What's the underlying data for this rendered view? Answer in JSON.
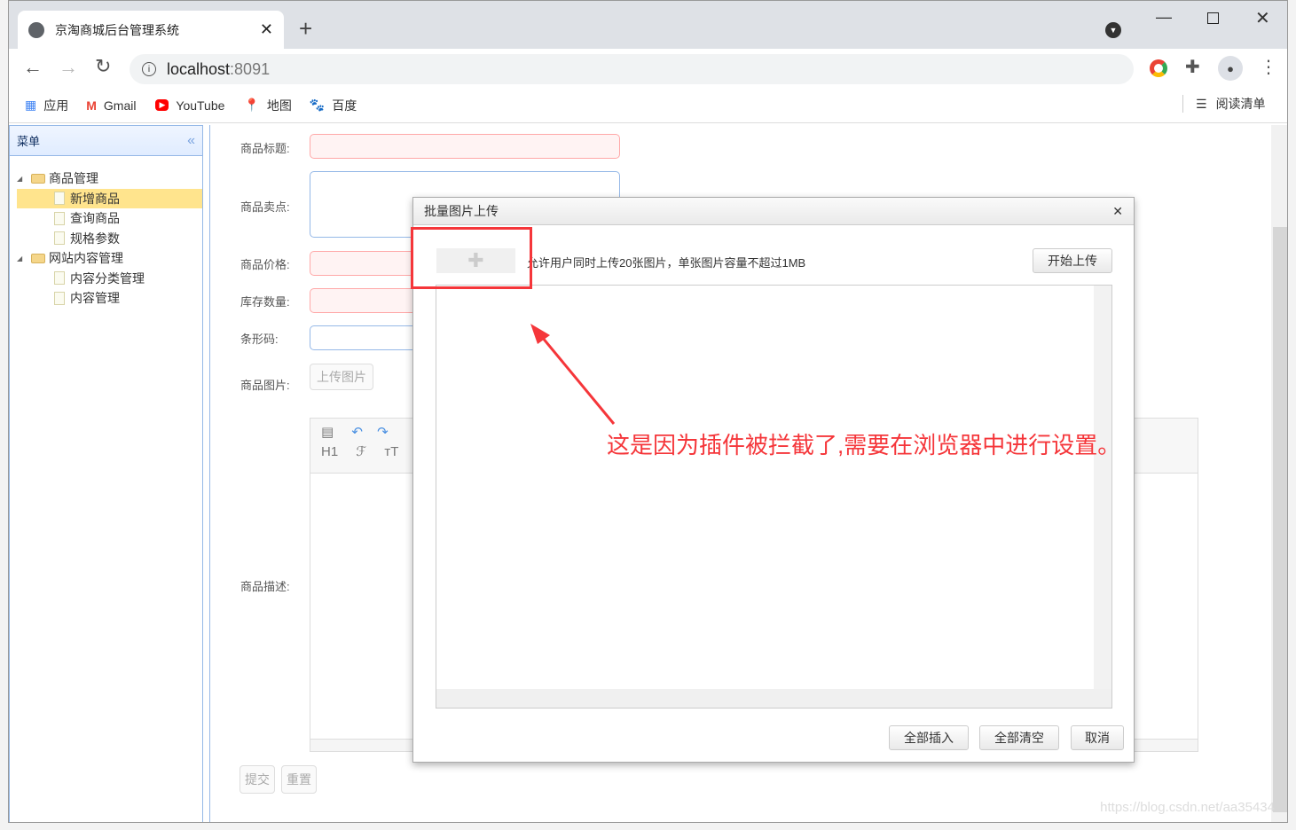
{
  "browser": {
    "tab_title": "京淘商城后台管理系统",
    "url_host": "localhost",
    "url_port": ":8091",
    "bookmarks": [
      "应用",
      "Gmail",
      "YouTube",
      "地图",
      "百度"
    ],
    "reading_list": "阅读清单"
  },
  "menu": {
    "title": "菜单",
    "groups": [
      {
        "label": "商品管理",
        "items": [
          "新增商品",
          "查询商品",
          "规格参数"
        ]
      },
      {
        "label": "网站内容管理",
        "items": [
          "内容分类管理",
          "内容管理"
        ]
      }
    ],
    "selected": "新增商品"
  },
  "form": {
    "title_label": "商品标题:",
    "sell_point_label": "商品卖点:",
    "price_label": "商品价格:",
    "stock_label": "库存数量:",
    "barcode_label": "条形码:",
    "image_label": "商品图片:",
    "upload_button": "上传图片",
    "desc_label": "商品描述:",
    "submit": "提交",
    "reset": "重置"
  },
  "editor": {
    "toolbar": [
      "paste-icon",
      "undo-icon",
      "redo-icon",
      "H1",
      "font-family",
      "font-size"
    ]
  },
  "dialog": {
    "title": "批量图片上传",
    "hint": "允许用户同时上传20张图片，单张图片容量不超过1MB",
    "start_upload": "开始上传",
    "insert_all": "全部插入",
    "clear_all": "全部清空",
    "cancel": "取消"
  },
  "annotation": {
    "text": "这是因为插件被拦截了,需要在浏览器中进行设置。",
    "color": "#f5363a"
  },
  "watermark": "https://blog.csdn.net/aa35434"
}
